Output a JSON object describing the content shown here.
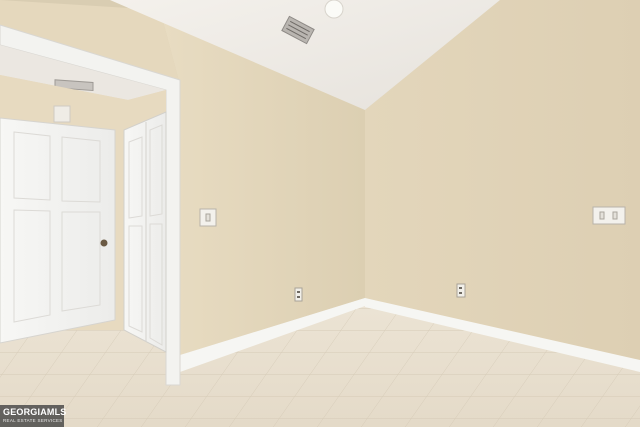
{
  "photo": {
    "subject": "empty-room-interior",
    "watermark": {
      "brand": "GEORGIAMLS",
      "tagline": "REAL ESTATE SERVICES"
    }
  }
}
